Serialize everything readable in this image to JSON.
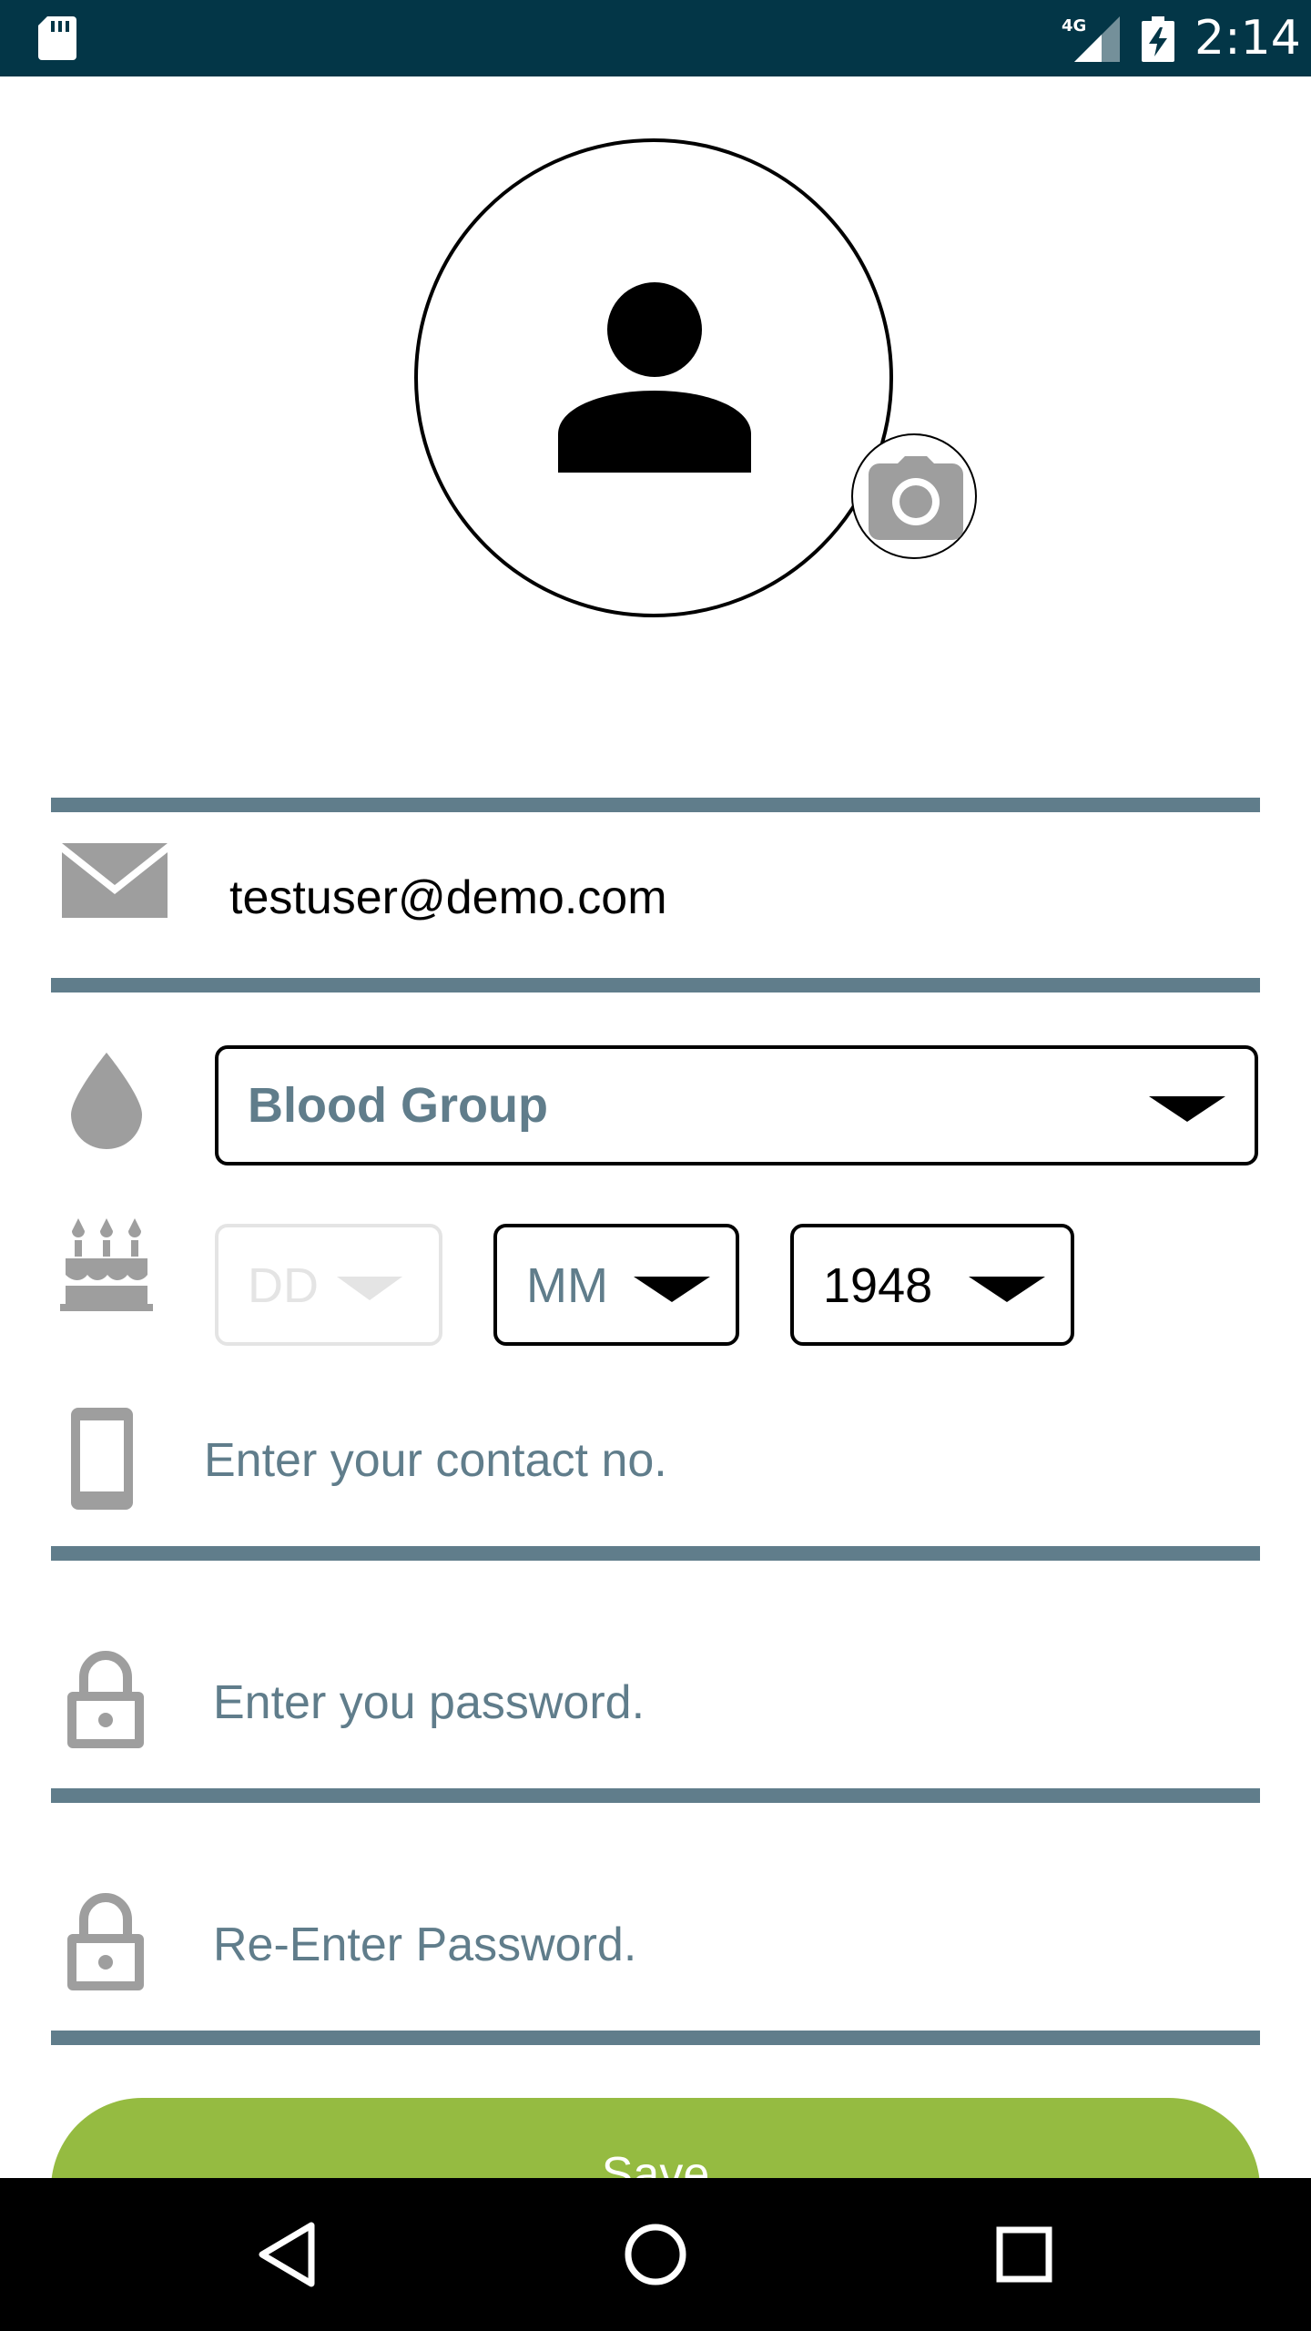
{
  "status_bar": {
    "time": "2:14",
    "network": "4G",
    "icons": [
      "sd-card-icon",
      "cellular-signal-icon",
      "battery-charging-icon"
    ]
  },
  "profile": {
    "avatar_icon": "person-icon",
    "camera_icon": "camera-icon"
  },
  "form": {
    "email": {
      "icon": "envelope-icon",
      "value": "testuser@demo.com"
    },
    "blood_group": {
      "icon": "drop-icon",
      "label": "Blood Group"
    },
    "dob": {
      "icon": "cake-icon",
      "day_placeholder": "DD",
      "month_placeholder": "MM",
      "year_value": "1948"
    },
    "contact": {
      "icon": "phone-icon",
      "placeholder": "Enter your contact no."
    },
    "password": {
      "icon": "lock-icon",
      "placeholder": "Enter you password."
    },
    "confirm_password": {
      "icon": "lock-icon",
      "placeholder": "Re-Enter Password."
    },
    "save_label": "Save"
  },
  "colors": {
    "status_bar": "#033647",
    "divider": "#607D8B",
    "icon_gray": "#9E9E9E",
    "save_button": "#95BB41",
    "disabled": "#E4E4E4"
  },
  "nav_bar": {
    "buttons": [
      "back-icon",
      "home-icon",
      "recents-icon"
    ]
  }
}
